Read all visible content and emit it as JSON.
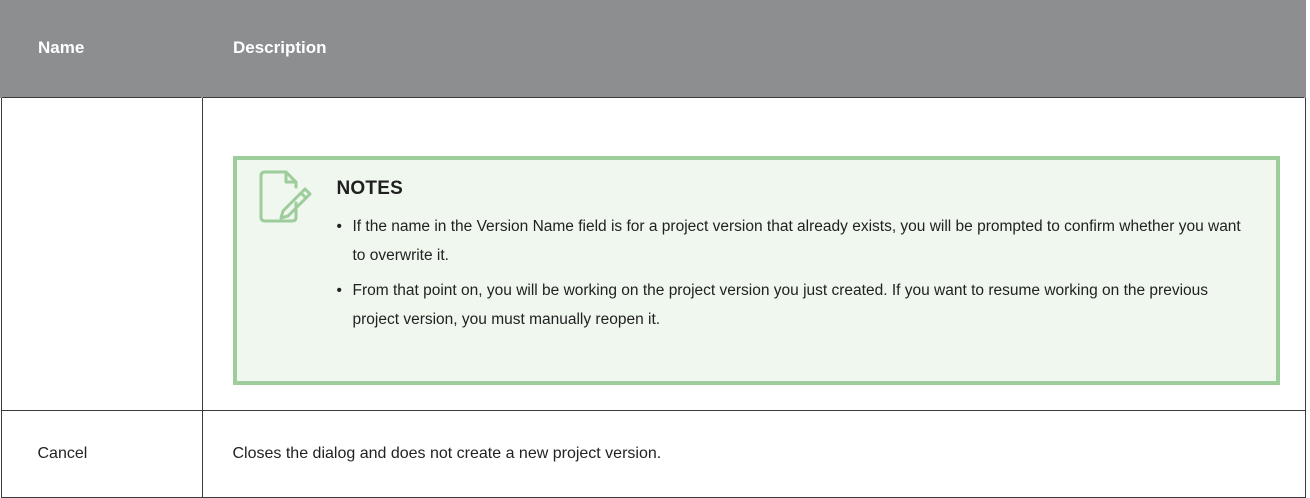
{
  "table": {
    "header": {
      "name": "Name",
      "description": "Description"
    },
    "rows": [
      {
        "name": "",
        "notes": {
          "icon": "note-edit-icon",
          "title": "NOTES",
          "items": [
            "If the name in the Version Name field is for a project version that already exists, you will be prompted to confirm whether you want to overwrite it.",
            "From that point on, you will be working on the project version you just created. If you want to resume working on the previous project version, you must manually reopen it."
          ]
        }
      },
      {
        "name": "Cancel",
        "description": "Closes the dialog and does not create a new project version."
      }
    ]
  },
  "colors": {
    "header_bg": "#8c8e90",
    "notes_border": "#9dcd9b",
    "notes_bg": "#eff7ef",
    "border": "#3b3b3b"
  }
}
